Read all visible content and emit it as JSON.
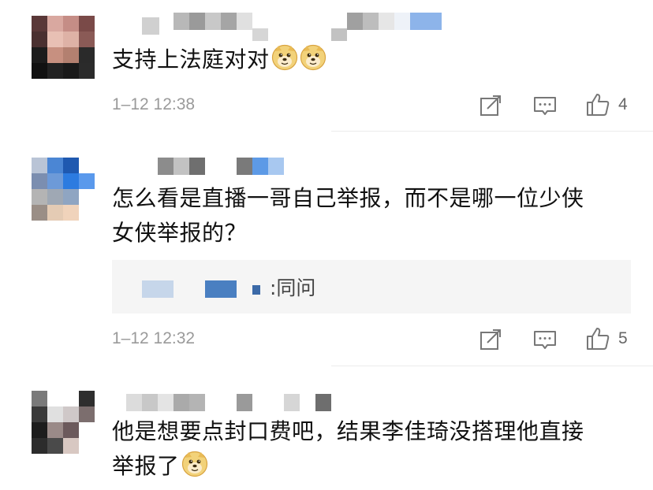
{
  "comments": [
    {
      "text": "支持上法庭对对",
      "emoji_count": 2,
      "time": "1–12 12:38",
      "likes": "4"
    },
    {
      "text_line1": "怎么看是直播一哥自己举报，而不是哪一位少侠",
      "text_line2": "女侠举报的？",
      "reply_text": ":同问",
      "time": "1–12 12:32",
      "likes": "5"
    },
    {
      "text_line1": "他是想要点封口费吧，结果李佳琦没搭理他直接",
      "text_line2": "举报了",
      "emoji_count": 1
    }
  ],
  "icons": [
    "share-icon",
    "comment-icon",
    "like-icon",
    "doge-emoji-icon"
  ],
  "colors": {
    "text": "#111111",
    "meta": "#9a9a9a",
    "reply_bg": "#f5f5f5",
    "divider": "#ececec",
    "blur_blue": "#4a7fc1"
  }
}
